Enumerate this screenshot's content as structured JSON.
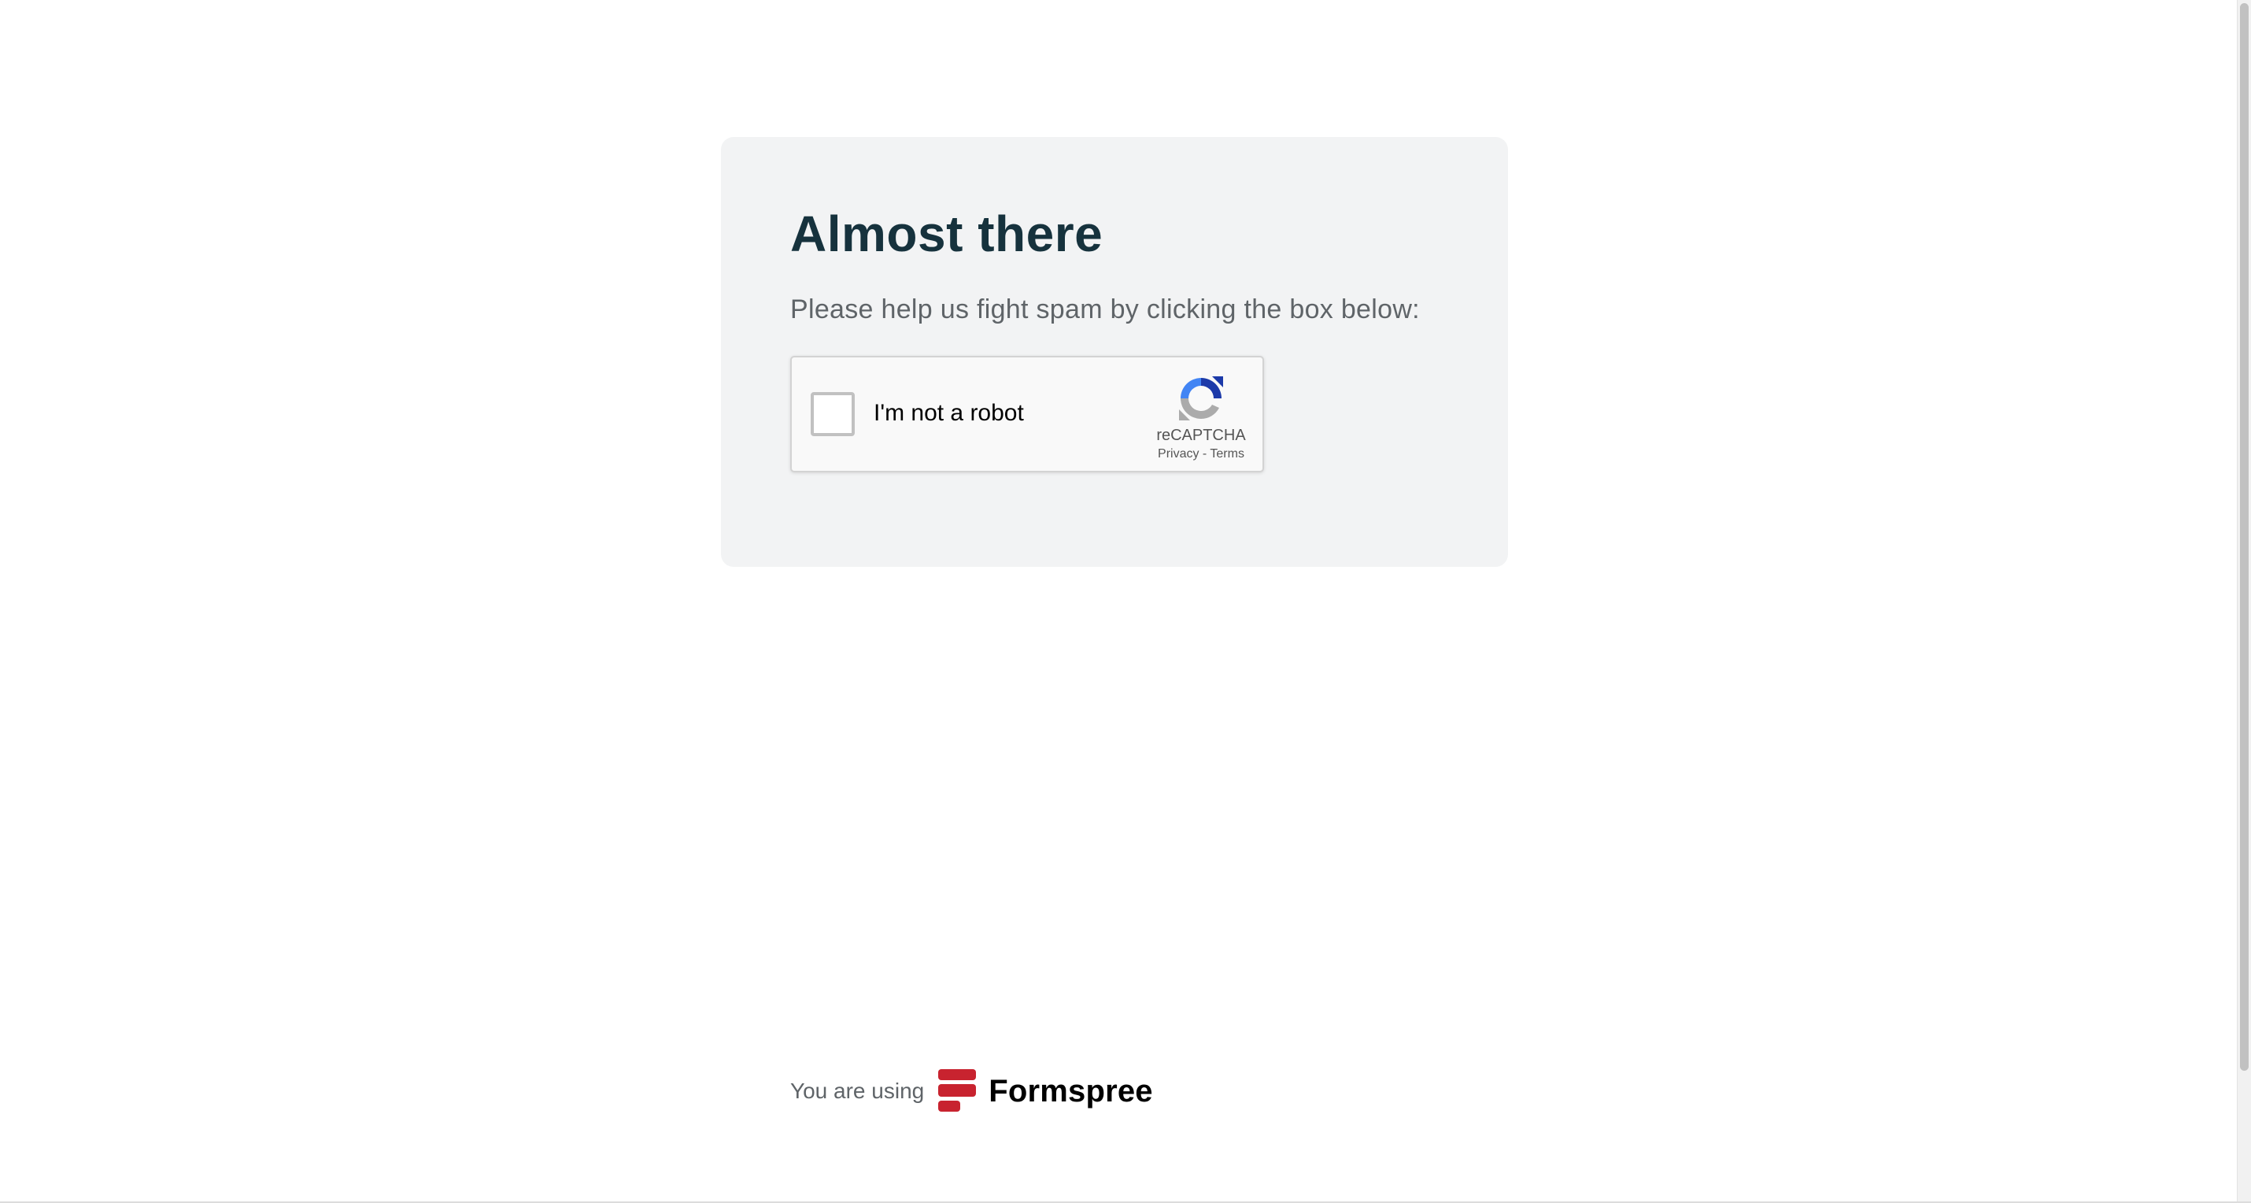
{
  "card": {
    "title": "Almost there",
    "subtitle": "Please help us fight spam by clicking the box below:"
  },
  "captcha": {
    "label": "I'm not a robot",
    "checked": false,
    "brand": "reCAPTCHA",
    "privacy_link": "Privacy",
    "separator": "-",
    "terms_link": "Terms",
    "icon": "recaptcha-logo-icon"
  },
  "footer": {
    "prefix": "You are using",
    "brand_name": "Formspree",
    "brand_icon": "formspree-logo-icon",
    "brand_color": "#c8232f"
  },
  "colors": {
    "title": "#16323d",
    "card_background": "#f2f3f4",
    "page_background": "#ffffff"
  }
}
